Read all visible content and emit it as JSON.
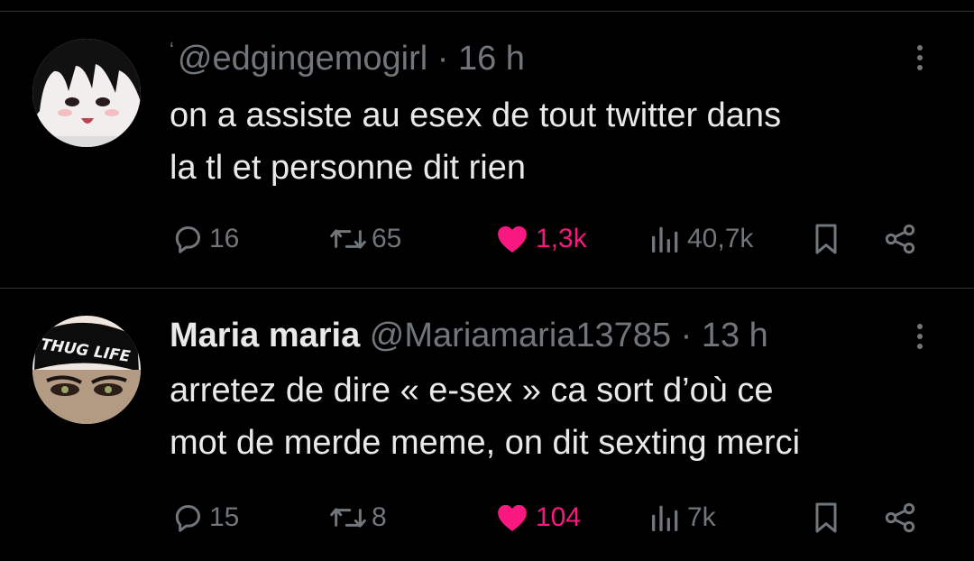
{
  "tweets": [
    {
      "handle": "@edgingemogirl",
      "time": "· 16 h",
      "text_line1": "on a assiste au esex de tout twitter dans",
      "text_line2": "la tl et personne dit rien",
      "replies": "16",
      "retweets": "65",
      "likes": "1,3k",
      "views": "40,7k"
    },
    {
      "name": "Maria maria",
      "handle": "@Mariamaria13785",
      "time": "· 13 h",
      "text_line1": "arretez de dire « e-sex » ca sort d’où ce",
      "text_line2": "mot de merde meme, on dit sexting merci",
      "replies": "15",
      "retweets": "8",
      "likes": "104",
      "views": "7k",
      "avatar_text": "THUG LIFE"
    }
  ],
  "colors": {
    "background": "#000000",
    "text": "#e7e9ea",
    "muted": "#71767b",
    "like": "#f91880",
    "divider": "#2f3336"
  },
  "icons": [
    "reply-icon",
    "retweet-icon",
    "heart-icon",
    "views-icon",
    "bookmark-icon",
    "share-icon",
    "more-icon"
  ]
}
